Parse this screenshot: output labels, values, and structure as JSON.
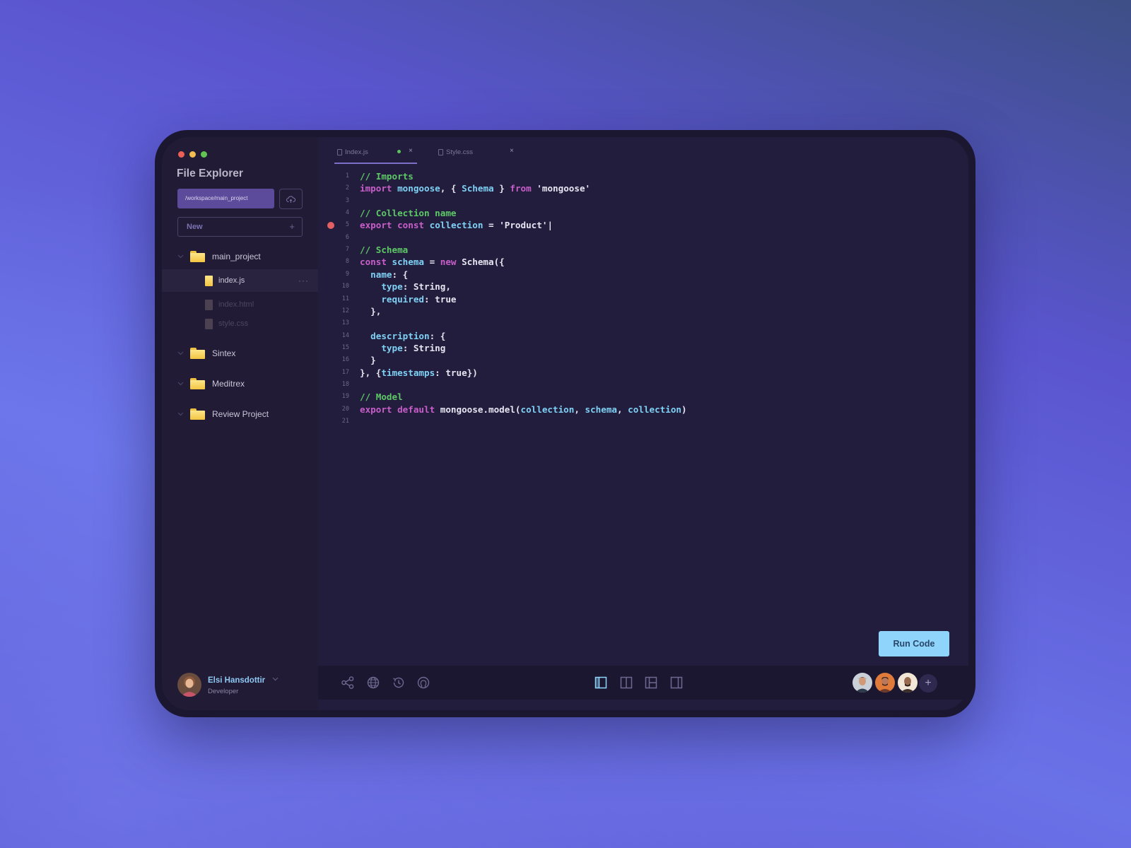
{
  "explorer": {
    "title": "File Explorer",
    "path": "/workspace/main_project",
    "new_label": "New",
    "new_plus": "+",
    "tree": [
      {
        "type": "folder",
        "label": "main_project"
      },
      {
        "type": "file",
        "label": "index.js",
        "active": true,
        "more": "···"
      },
      {
        "type": "file",
        "label": "index.html",
        "dim": true
      },
      {
        "type": "file",
        "label": "style.css",
        "dim": true
      },
      {
        "type": "folder",
        "label": "Sintex"
      },
      {
        "type": "folder",
        "label": "Meditrex"
      },
      {
        "type": "folder",
        "label": "Review Project"
      }
    ]
  },
  "user": {
    "name": "Elsi Hansdottir",
    "role": "Developer"
  },
  "tabs": [
    {
      "label": "Index.js",
      "modified": true,
      "close": "×"
    },
    {
      "label": "Style.css",
      "modified": false,
      "close": "×"
    }
  ],
  "code": {
    "breakpoint_line": 5,
    "lines": [
      {
        "n": "1",
        "tokens": [
          [
            "comment",
            "// Imports"
          ]
        ]
      },
      {
        "n": "2",
        "tokens": [
          [
            "kw",
            "import"
          ],
          [
            "plain",
            " "
          ],
          [
            "id",
            "mongoose"
          ],
          [
            "plain",
            ", { "
          ],
          [
            "id",
            "Schema"
          ],
          [
            "plain",
            " } "
          ],
          [
            "kw",
            "from"
          ],
          [
            "plain",
            " "
          ],
          [
            "str",
            "'mongoose'"
          ]
        ]
      },
      {
        "n": "3",
        "tokens": []
      },
      {
        "n": "4",
        "tokens": [
          [
            "comment",
            "// Collection name"
          ]
        ]
      },
      {
        "n": "5",
        "tokens": [
          [
            "kw",
            "export"
          ],
          [
            "plain",
            " "
          ],
          [
            "kw",
            "const"
          ],
          [
            "plain",
            " "
          ],
          [
            "id",
            "collection"
          ],
          [
            "plain",
            " = "
          ],
          [
            "str",
            "'Product'"
          ],
          [
            "cursor",
            "|"
          ]
        ]
      },
      {
        "n": "6",
        "tokens": []
      },
      {
        "n": "7",
        "tokens": [
          [
            "comment",
            "// Schema"
          ]
        ]
      },
      {
        "n": "8",
        "tokens": [
          [
            "kw",
            "const"
          ],
          [
            "plain",
            " "
          ],
          [
            "id",
            "schema"
          ],
          [
            "plain",
            " = "
          ],
          [
            "kw",
            "new"
          ],
          [
            "plain",
            " Schema({"
          ]
        ]
      },
      {
        "n": "9",
        "tokens": [
          [
            "plain",
            "  "
          ],
          [
            "id",
            "name"
          ],
          [
            "plain",
            ": {"
          ]
        ]
      },
      {
        "n": "10",
        "tokens": [
          [
            "plain",
            "    "
          ],
          [
            "id",
            "type"
          ],
          [
            "plain",
            ": String,"
          ]
        ]
      },
      {
        "n": "11",
        "tokens": [
          [
            "plain",
            "    "
          ],
          [
            "id",
            "required"
          ],
          [
            "plain",
            ": true"
          ]
        ]
      },
      {
        "n": "12",
        "tokens": [
          [
            "plain",
            "  },"
          ]
        ]
      },
      {
        "n": "13",
        "tokens": []
      },
      {
        "n": "14",
        "tokens": [
          [
            "plain",
            "  "
          ],
          [
            "id",
            "description"
          ],
          [
            "plain",
            ": {"
          ]
        ]
      },
      {
        "n": "15",
        "tokens": [
          [
            "plain",
            "    "
          ],
          [
            "id",
            "type"
          ],
          [
            "plain",
            ": String"
          ]
        ]
      },
      {
        "n": "16",
        "tokens": [
          [
            "plain",
            "  }"
          ]
        ]
      },
      {
        "n": "17",
        "tokens": [
          [
            "plain",
            "}, {"
          ],
          [
            "id",
            "timestamps"
          ],
          [
            "plain",
            ": true})"
          ]
        ]
      },
      {
        "n": "18",
        "tokens": []
      },
      {
        "n": "19",
        "tokens": [
          [
            "comment",
            "// Model"
          ]
        ]
      },
      {
        "n": "20",
        "tokens": [
          [
            "kw",
            "export"
          ],
          [
            "plain",
            " "
          ],
          [
            "kw",
            "default"
          ],
          [
            "plain",
            " mongoose.model("
          ],
          [
            "id",
            "collection"
          ],
          [
            "plain",
            ", "
          ],
          [
            "id",
            "schema"
          ],
          [
            "plain",
            ", "
          ],
          [
            "id",
            "collection"
          ],
          [
            "plain",
            ")"
          ]
        ]
      },
      {
        "n": "21",
        "tokens": []
      }
    ]
  },
  "run_button": "Run Code",
  "toolbar": {
    "left_icons": [
      "share-icon",
      "globe-icon",
      "history-icon",
      "github-icon"
    ],
    "layout_icons": [
      "layout-sidebar-left-icon",
      "layout-split-icon",
      "layout-grid-icon",
      "layout-sidebar-right-icon"
    ],
    "active_layout": "layout-sidebar-left-icon",
    "collaborators": 3,
    "add_label": "+"
  },
  "colors": {
    "accent_blue": "#8fd5fb",
    "keyword": "#c85ec9",
    "identifier": "#7fd1f5",
    "comment": "#5ec867",
    "breakpoint": "#e25f62"
  }
}
